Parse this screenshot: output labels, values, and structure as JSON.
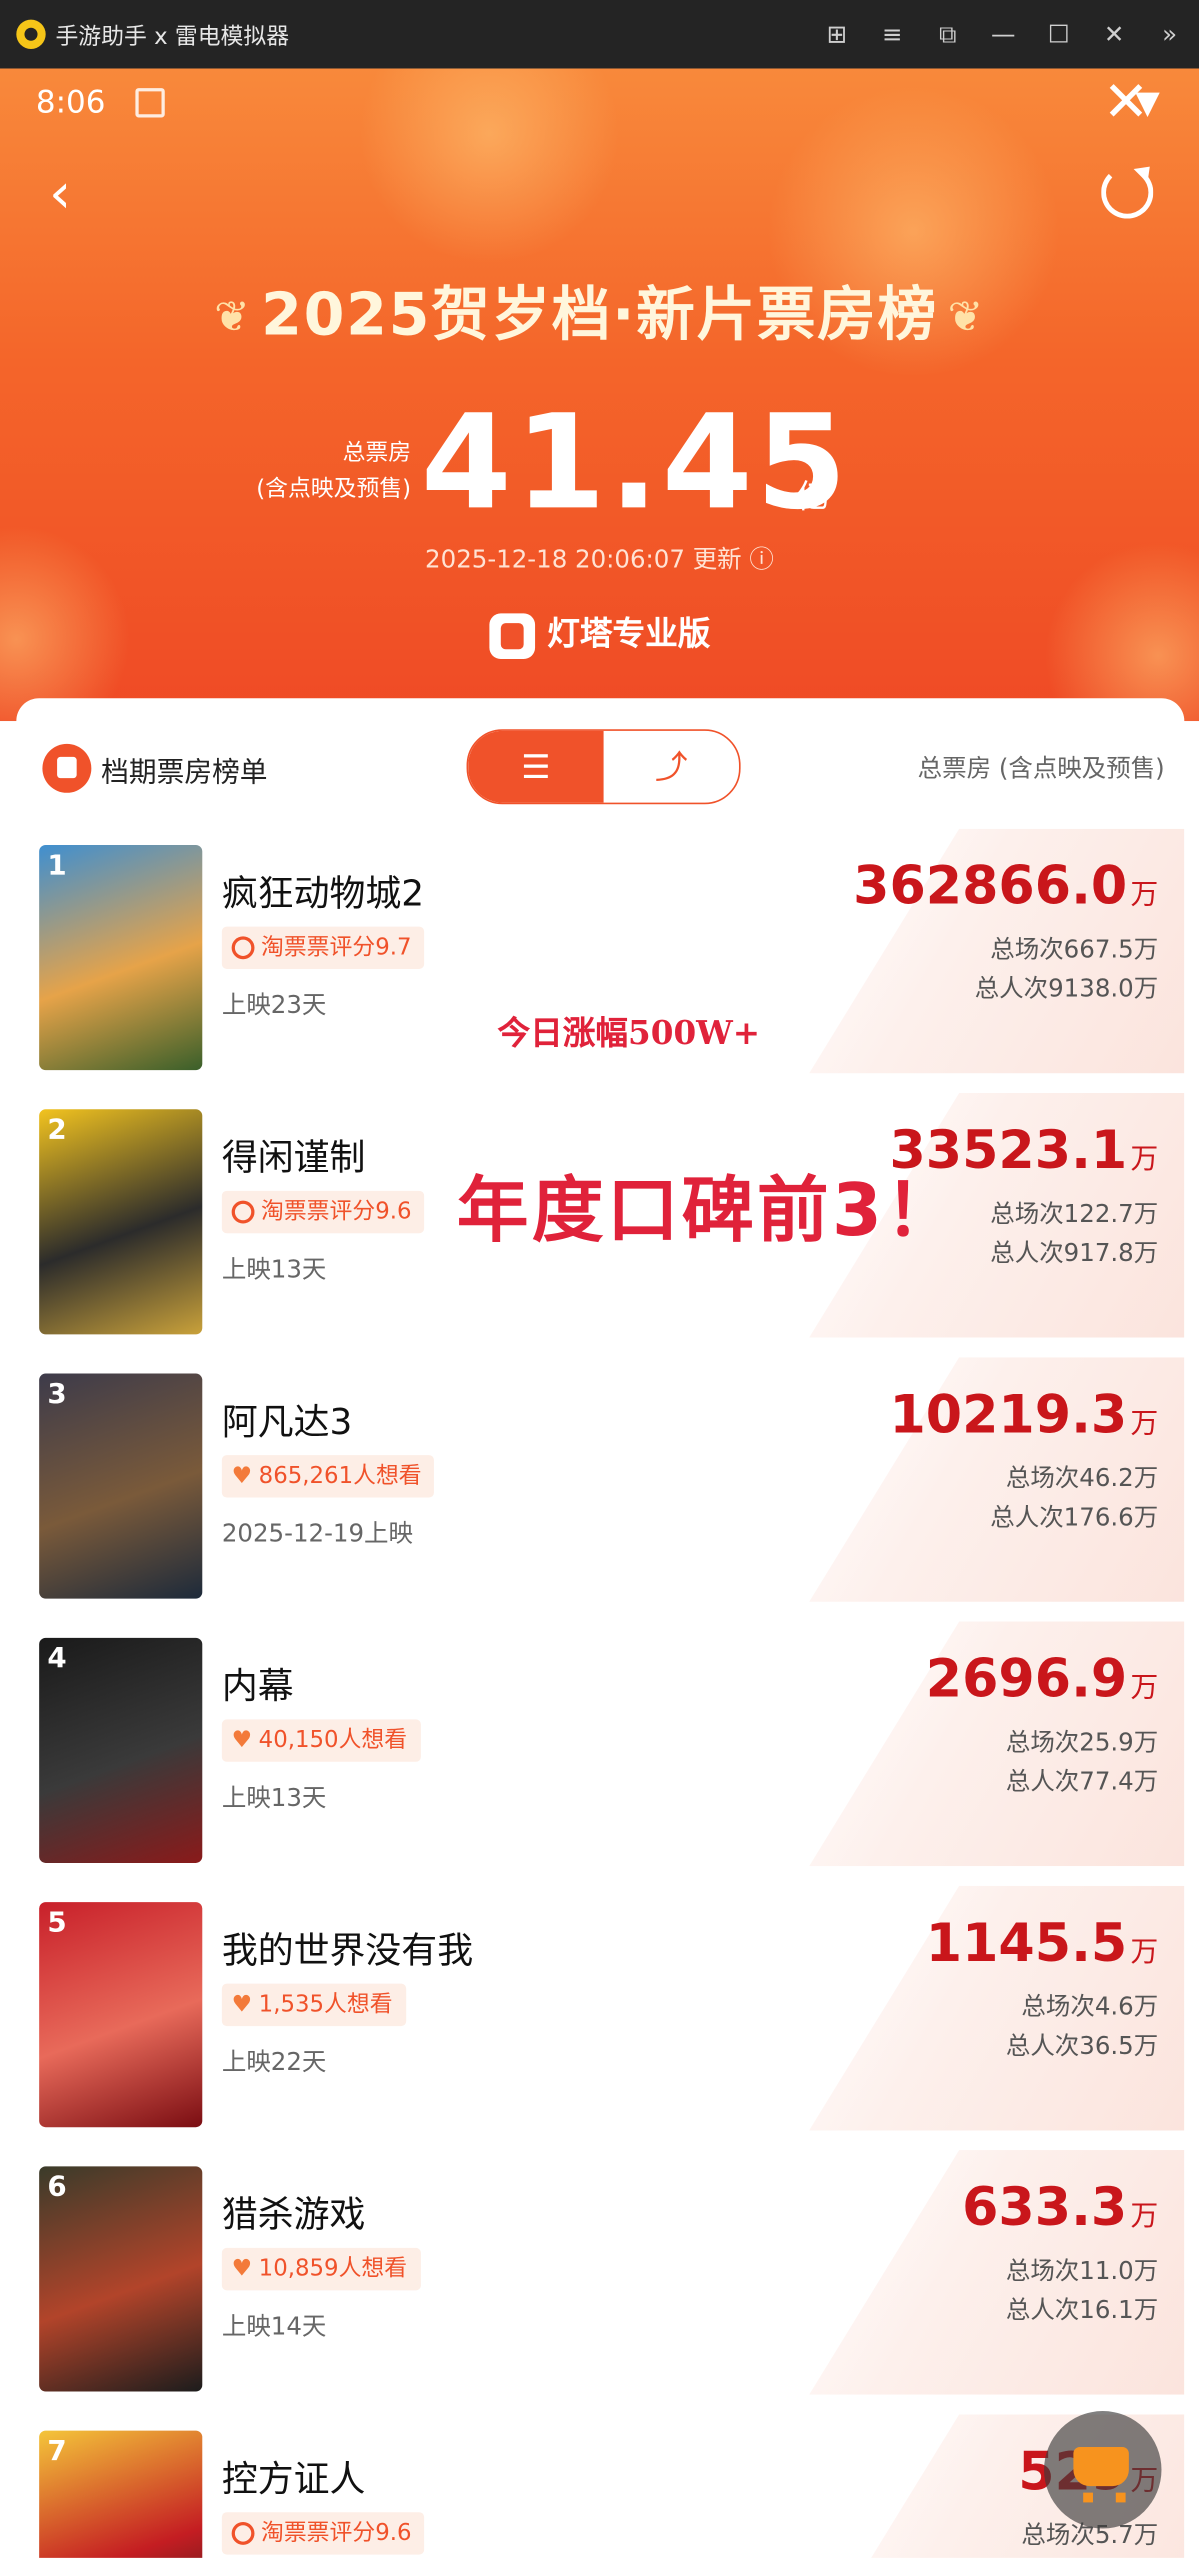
{
  "window": {
    "title": "手游助手 x 雷电模拟器"
  },
  "status": {
    "time": "8:06"
  },
  "header": {
    "title": "2025贺岁档·新片票房榜",
    "total_label_1": "总票房",
    "total_label_2": "(含点映及预售)",
    "total_value": "41.45",
    "total_unit": "亿",
    "update": "2025-12-18 20:06:07 更新 ⓘ",
    "brand": "灯塔专业版"
  },
  "panel": {
    "title": "档期票房榜单",
    "right_label": "总票房 (含点映及预售)"
  },
  "overlays": {
    "line1": "今日涨幅500W+",
    "line2": "年度口碑前3！"
  },
  "movies": [
    {
      "rank": "1",
      "name": "疯狂动物城2",
      "tag_type": "score",
      "tag": "淘票票评分9.7",
      "sub": "上映23天",
      "boxoffice": "362866.0",
      "unit": "万",
      "sessions": "总场次667.5万",
      "viewers": "总人次9138.0万",
      "poster_colors": [
        "#3f8fd0",
        "#e6a349",
        "#3a5f2a"
      ]
    },
    {
      "rank": "2",
      "name": "得闲谨制",
      "tag_type": "score",
      "tag": "淘票票评分9.6",
      "sub": "上映13天",
      "boxoffice": "33523.1",
      "unit": "万",
      "sessions": "总场次122.7万",
      "viewers": "总人次917.8万",
      "poster_colors": [
        "#f2c31f",
        "#2b2b2b",
        "#c9a13a"
      ]
    },
    {
      "rank": "3",
      "name": "阿凡达3",
      "tag_type": "want",
      "tag": "865,261人想看",
      "sub": "2025-12-19上映",
      "boxoffice": "10219.3",
      "unit": "万",
      "sessions": "总场次46.2万",
      "viewers": "总人次176.6万",
      "poster_colors": [
        "#3d3b4a",
        "#7a5a3a",
        "#1d2a3a"
      ]
    },
    {
      "rank": "4",
      "name": "内幕",
      "tag_type": "want",
      "tag": "40,150人想看",
      "sub": "上映13天",
      "boxoffice": "2696.9",
      "unit": "万",
      "sessions": "总场次25.9万",
      "viewers": "总人次77.4万",
      "poster_colors": [
        "#1a1a1a",
        "#3a3a3a",
        "#8a1a1a"
      ]
    },
    {
      "rank": "5",
      "name": "我的世界没有我",
      "tag_type": "want",
      "tag": "1,535人想看",
      "sub": "上映22天",
      "boxoffice": "1145.5",
      "unit": "万",
      "sessions": "总场次4.6万",
      "viewers": "总人次36.5万",
      "poster_colors": [
        "#c8202a",
        "#e86a5a",
        "#7a0d12"
      ]
    },
    {
      "rank": "6",
      "name": "猎杀游戏",
      "tag_type": "want",
      "tag": "10,859人想看",
      "sub": "上映14天",
      "boxoffice": "633.3",
      "unit": "万",
      "sessions": "总场次11.0万",
      "viewers": "总人次16.1万",
      "poster_colors": [
        "#3a3b2a",
        "#b2442a",
        "#1c1c1c"
      ]
    },
    {
      "rank": "7",
      "name": "控方证人",
      "tag_type": "score",
      "tag": "淘票票评分9.6",
      "sub": "",
      "boxoffice": "529",
      "unit": "万",
      "sessions": "总场次5.7万",
      "viewers": "",
      "poster_colors": [
        "#f4c53a",
        "#c41d22",
        "#1a1a1a"
      ]
    }
  ],
  "colors": {
    "accent": "#f0522a",
    "value_red": "#c9161b"
  }
}
